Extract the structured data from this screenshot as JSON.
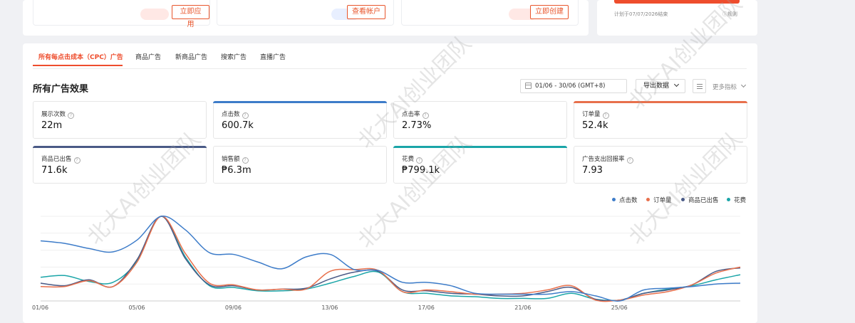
{
  "top_cards": {
    "apply_now": "立即应用",
    "view_account": "查看帐户",
    "create_now": "立即创建",
    "plan_note": "计划于07/07/2026结束",
    "rules": "规则"
  },
  "tabs": [
    {
      "label": "所有每点击成本（CPC）广告"
    },
    {
      "label": "商品广告"
    },
    {
      "label": "新商品广告"
    },
    {
      "label": "搜索广告"
    },
    {
      "label": "直播广告"
    }
  ],
  "section": {
    "title": "所有广告效果",
    "date_range": "01/06 - 30/06 (GMT+8)",
    "export": "导出数据",
    "more_metrics": "更多指标"
  },
  "metrics": [
    {
      "label": "展示次数",
      "value": "22m"
    },
    {
      "label": "点击数",
      "value": "600.7k",
      "color": "#3d7cc9"
    },
    {
      "label": "点击率",
      "value": "2.73%"
    },
    {
      "label": "订单量",
      "value": "52.4k",
      "color": "#e8704c"
    },
    {
      "label": "商品已出售",
      "value": "71.6k",
      "color": "#4a5a86"
    },
    {
      "label": "销售额",
      "value": "₱6.3m"
    },
    {
      "label": "花费",
      "value": "₱799.1k",
      "color": "#1aa5a8"
    },
    {
      "label": "广告支出回报率",
      "value": "7.93"
    }
  ],
  "watermark": "北大AI创业团队",
  "chart_data": {
    "type": "line",
    "x": [
      "01/06",
      "02/06",
      "03/06",
      "04/06",
      "05/06",
      "06/06",
      "07/06",
      "08/06",
      "09/06",
      "10/06",
      "11/06",
      "12/06",
      "13/06",
      "14/06",
      "15/06",
      "16/06",
      "17/06",
      "18/06",
      "19/06",
      "20/06",
      "21/06",
      "22/06",
      "23/06",
      "24/06",
      "25/06",
      "26/06",
      "27/06",
      "28/06",
      "29/06",
      "30/06"
    ],
    "xticks": [
      "01/06",
      "05/06",
      "09/06",
      "13/06",
      "17/06",
      "21/06",
      "25/06"
    ],
    "legend_position": "top-right",
    "grid": true,
    "ylim": [
      0,
      100
    ],
    "series": [
      {
        "name": "点击数",
        "color": "#3d7cc9",
        "values": [
          71,
          68,
          62,
          58,
          72,
          100,
          84,
          57,
          55,
          46,
          38,
          52,
          55,
          37,
          36,
          22,
          22,
          18,
          9,
          8,
          8,
          8,
          11,
          6,
          0,
          13,
          15,
          17,
          20,
          21
        ]
      },
      {
        "name": "订单量",
        "color": "#e8704c",
        "values": [
          17,
          17,
          24,
          17,
          46,
          100,
          56,
          21,
          19,
          13,
          14,
          14,
          35,
          37,
          36,
          11,
          13,
          11,
          8,
          8,
          9,
          13,
          18,
          1,
          1,
          7,
          11,
          19,
          33,
          40
        ]
      },
      {
        "name": "商品已出售",
        "color": "#4a5a86",
        "values": [
          21,
          18,
          25,
          17,
          49,
          100,
          50,
          19,
          18,
          13,
          14,
          15,
          26,
          34,
          35,
          13,
          12,
          9,
          8,
          6,
          6,
          11,
          16,
          2,
          1,
          9,
          13,
          19,
          35,
          39
        ]
      },
      {
        "name": "花费",
        "color": "#1aa5a8",
        "values": [
          28,
          30,
          23,
          22,
          47,
          100,
          52,
          18,
          16,
          12,
          12,
          14,
          21,
          29,
          34,
          11,
          9,
          6,
          5,
          3,
          3,
          3,
          9,
          2,
          1,
          9,
          14,
          18,
          25,
          31
        ]
      }
    ]
  }
}
